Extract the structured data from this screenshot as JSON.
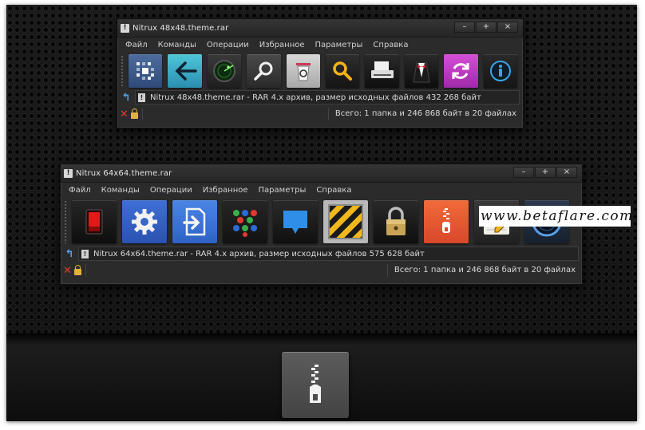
{
  "window1": {
    "title": "Nitrux 48x48.theme.rar",
    "controls": {
      "minimize": "–",
      "maximize": "+",
      "close": "×"
    },
    "menu": [
      "Файл",
      "Команды",
      "Операции",
      "Избранное",
      "Параметры",
      "Справка"
    ],
    "toolbar_icons": [
      "add-archive-icon",
      "back-arrow-icon",
      "radar-icon",
      "magnifier-icon",
      "recycle-bin-icon",
      "search-icon",
      "printer-icon",
      "tuxedo-icon",
      "sync-icon",
      "info-icon"
    ],
    "path_text": "Nitrux 48x48.theme.rar - RAR 4.x архив, размер исходных файлов 432 268 байт",
    "status_text": "Всего: 1 папка и 246 868 байт в 20 файлах"
  },
  "window2": {
    "title": "Nitrux 64x64.theme.rar",
    "controls": {
      "minimize": "–",
      "maximize": "+",
      "close": "×"
    },
    "menu": [
      "Файл",
      "Команды",
      "Операции",
      "Избранное",
      "Параметры",
      "Справка"
    ],
    "toolbar_icons": [
      "red-switch-icon",
      "gear-icon",
      "extract-arrow-icon",
      "colored-dots-icon",
      "speech-bubble-icon",
      "hazard-stripes-icon",
      "padlock-icon",
      "zip-file-icon",
      "notepad-icon",
      "speedometer-icon"
    ],
    "path_text": "Nitrux 64x64.theme.rar - RAR 4.x архив, размер исходных файлов 575 628 байт",
    "status_text": "Всего: 1 папка и 246 868 байт в 20 файлах"
  },
  "watermark": "www.betaflare.com",
  "dock": {
    "icon": "zip-archive-icon"
  },
  "colors": {
    "window_bg": "#2b2b2b",
    "text": "#d8d8d8",
    "accent_blue": "#3a6fd0",
    "accent_red": "#e03a2c"
  }
}
